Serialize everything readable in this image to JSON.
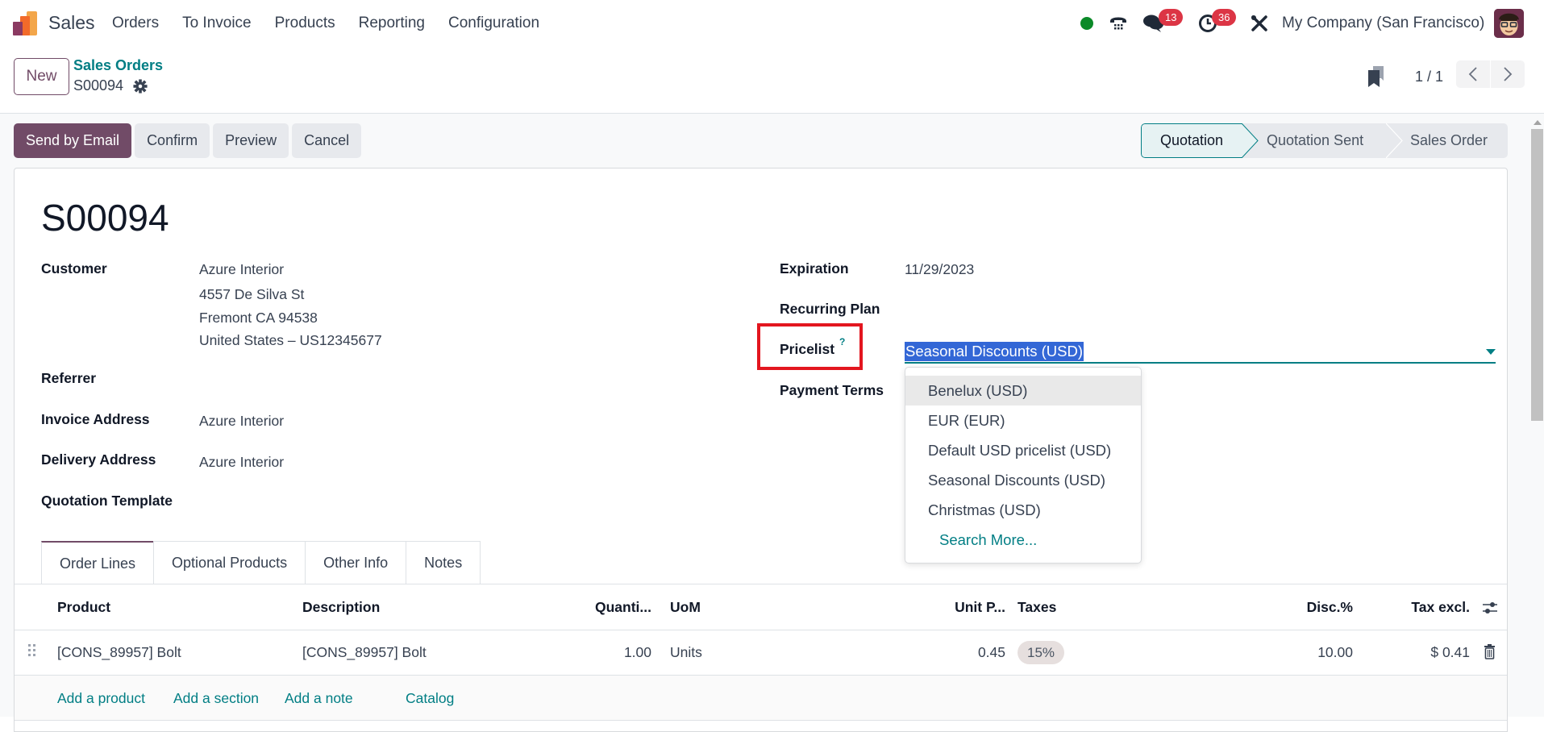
{
  "navbar": {
    "app_name": "Sales",
    "menu": [
      "Orders",
      "To Invoice",
      "Products",
      "Reporting",
      "Configuration"
    ],
    "messages_count": "13",
    "activities_count": "36",
    "company": "My Company (San Francisco)",
    "presence_color": "#0b8a28"
  },
  "control_panel": {
    "new_label": "New",
    "breadcrumb_parent": "Sales Orders",
    "breadcrumb_current": "S00094",
    "pager_value": "1 / 1"
  },
  "actions": {
    "send_email": "Send by Email",
    "confirm": "Confirm",
    "preview": "Preview",
    "cancel": "Cancel"
  },
  "statusbar": {
    "stages": [
      "Quotation",
      "Quotation Sent",
      "Sales Order"
    ],
    "active": "Quotation"
  },
  "form": {
    "title": "S00094",
    "left": {
      "customer_label": "Customer",
      "customer_name": "Azure Interior",
      "customer_street": "4557 De Silva St",
      "customer_city": "Fremont CA 94538",
      "customer_country": "United States – US12345677",
      "referrer_label": "Referrer",
      "invoice_address_label": "Invoice Address",
      "invoice_address": "Azure Interior",
      "delivery_address_label": "Delivery Address",
      "delivery_address": "Azure Interior",
      "quotation_template_label": "Quotation Template"
    },
    "right": {
      "expiration_label": "Expiration",
      "expiration": "11/29/2023",
      "recurring_plan_label": "Recurring Plan",
      "pricelist_label": "Pricelist",
      "pricelist_help": "?",
      "pricelist_value": "Seasonal Discounts (USD)",
      "payment_terms_label": "Payment Terms"
    },
    "pricelist_dropdown": {
      "options": [
        "Benelux (USD)",
        "EUR (EUR)",
        "Default USD pricelist (USD)",
        "Seasonal Discounts (USD)",
        "Christmas (USD)"
      ],
      "highlighted": "Benelux (USD)",
      "search_more": "Search More..."
    }
  },
  "tabs": [
    "Order Lines",
    "Optional Products",
    "Other Info",
    "Notes"
  ],
  "order_lines": {
    "columns": [
      "Product",
      "Description",
      "Quanti...",
      "UoM",
      "Unit P...",
      "Taxes",
      "Disc.%",
      "Tax excl."
    ],
    "rows": [
      {
        "product": "[CONS_89957] Bolt",
        "description": "[CONS_89957] Bolt",
        "quantity": "1.00",
        "uom": "Units",
        "unit_price": "0.45",
        "taxes": "15%",
        "discount": "10.00",
        "subtotal": "$ 0.41"
      }
    ],
    "add_product": "Add a product",
    "add_section": "Add a section",
    "add_note": "Add a note",
    "catalog": "Catalog"
  },
  "colors": {
    "brand": "#714b67",
    "link": "#017e84",
    "badge": "#dc3545",
    "highlight_box": "#e3161f"
  }
}
